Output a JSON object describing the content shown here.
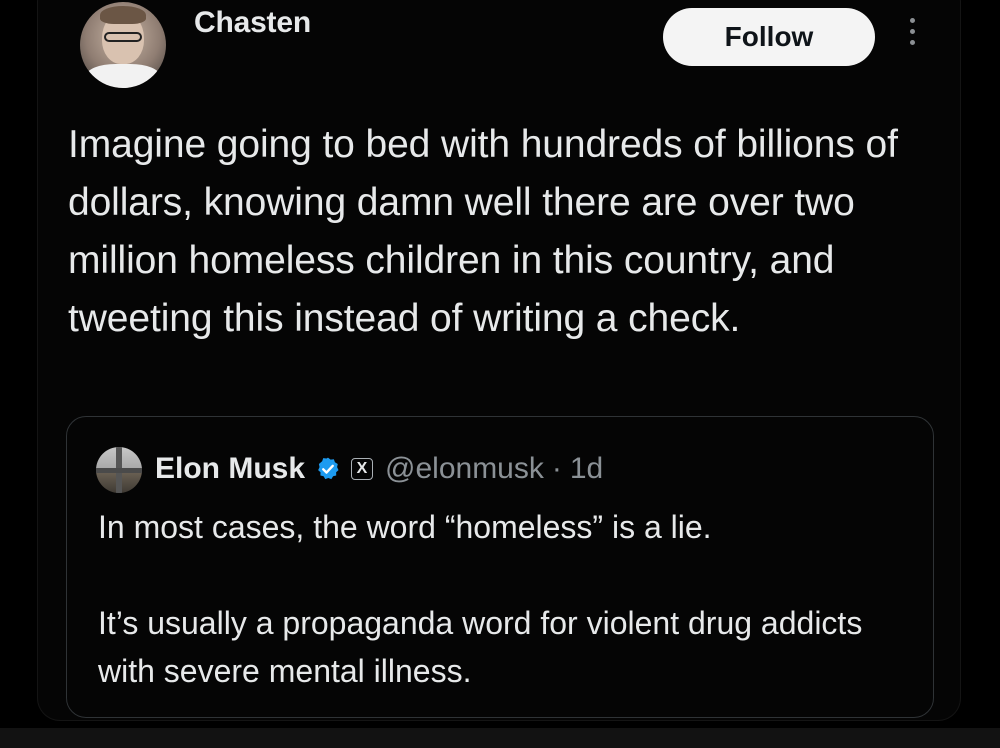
{
  "post": {
    "author_name": "Chasten",
    "follow_label": "Follow",
    "more_icon": "more-vertical-icon",
    "text": "Imagine going to bed with hundreds of billions of dollars, knowing damn well there are over two million homeless children in this country, and tweeting this instead of writing a check."
  },
  "quote": {
    "name": "Elon Musk",
    "verified_icon": "verified-badge-icon",
    "verified_color": "#1d9bf0",
    "x_badge_icon": "x-logo-icon",
    "x_badge_text": "X",
    "handle": "@elonmusk",
    "separator": "·",
    "time": "1d",
    "paragraphs": [
      "In most cases, the word “homeless” is a lie.",
      "It’s usually a propaganda word for violent drug addicts with severe mental illness."
    ]
  },
  "colors": {
    "background": "#000000",
    "text": "#e7e9ea",
    "secondary_text": "#8b9196",
    "follow_button_bg": "#f4f4f4",
    "border": "#2f3336"
  }
}
